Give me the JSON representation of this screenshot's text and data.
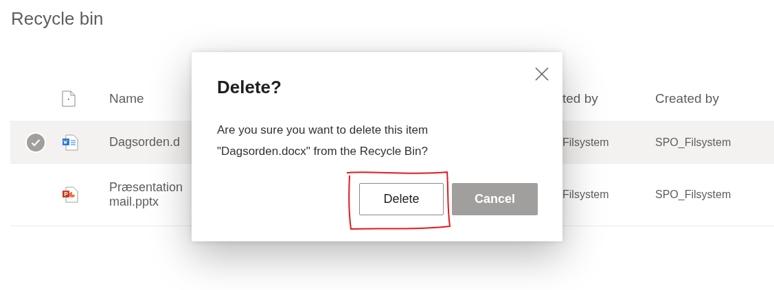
{
  "page": {
    "title": "Recycle bin"
  },
  "table": {
    "columns": [
      {
        "kind": "file-type"
      },
      {
        "kind": "text",
        "label": "Name"
      },
      {
        "kind": "text",
        "label": "ted by"
      },
      {
        "kind": "text",
        "label": "Created by"
      }
    ],
    "rows": [
      {
        "selected": true,
        "kind": "word",
        "name_lines": [
          "Dagsorden.d"
        ],
        "column_3": "Filsystem",
        "created_by": "SPO_Filsystem"
      },
      {
        "selected": false,
        "kind": "powerpoint",
        "name_lines": [
          "Præsentation",
          "mail.pptx"
        ],
        "column_3": "Filsystem",
        "created_by": "SPO_Filsystem"
      }
    ]
  },
  "dialog": {
    "title": "Delete?",
    "message_lines": [
      "Are you sure you want to delete this item",
      "\"Dagsorden.docx\" from the Recycle Bin?"
    ],
    "buttons": [
      {
        "label": "Delete",
        "kind": "outline"
      },
      {
        "label": "Cancel",
        "kind": "filled"
      }
    ],
    "annotation": {
      "kind": "freehand-box"
    }
  }
}
